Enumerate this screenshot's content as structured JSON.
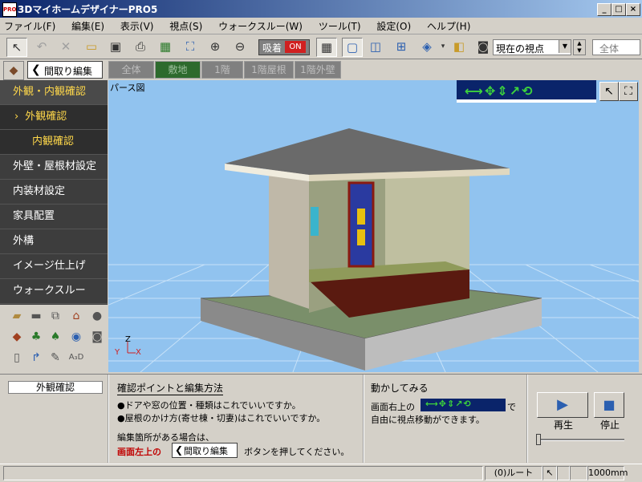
{
  "window": {
    "title": "3DマイホームデザイナーPRO5",
    "icon_text": "PRO"
  },
  "menu": [
    "ファイル(F)",
    "編集(E)",
    "表示(V)",
    "視点(S)",
    "ウォークスルー(W)",
    "ツール(T)",
    "設定(O)",
    "ヘルプ(H)"
  ],
  "toolbar": {
    "adsorb_label": "吸着",
    "adsorb_state": "ON",
    "view_select": "現在の視点",
    "all_field": "全体"
  },
  "row2": {
    "madori_button": "間取り編集",
    "floor_tabs": [
      "全体",
      "敷地",
      "1階",
      "1階屋根",
      "1階外壁"
    ],
    "selected_tab": 1
  },
  "leftnav": [
    {
      "label": "外観・内観確認",
      "style": "gold"
    },
    {
      "label": "外観確認",
      "style": "sub",
      "chevron": "›"
    },
    {
      "label": "内観確認",
      "style": "sub"
    },
    {
      "label": "外壁・屋根材設定",
      "style": "normal"
    },
    {
      "label": "内装材設定",
      "style": "normal"
    },
    {
      "label": "家具配置",
      "style": "normal"
    },
    {
      "label": "外構",
      "style": "normal"
    },
    {
      "label": "イメージ仕上げ",
      "style": "normal"
    },
    {
      "label": "ウォークスルー",
      "style": "normal"
    }
  ],
  "viewport": {
    "label": "パース図",
    "axis_z": "Z",
    "axis_y": "Y",
    "axis_x": "X"
  },
  "bottom": {
    "view_name": "外観確認",
    "check_heading": "確認ポイントと編集方法",
    "bullet1": "●ドアや窓の位置・種類はこれでいいですか。",
    "bullet2": "●屋根のかけ方(寄せ棟・切妻)はこれでいいですか。",
    "edit_hint": "編集箇所がある場合は、",
    "red_label": "画面左上の",
    "madori_button": "間取り編集",
    "press_text": "ボタンを押してください。",
    "move_heading": "動かしてみる",
    "move_line1a": "画面右上の",
    "move_line1b": "で",
    "move_line2": "自由に視点移動ができます。",
    "play_label": "再生",
    "stop_label": "停止"
  },
  "status": {
    "root": "(0)ルート",
    "scale": "1000mm"
  },
  "colors": {
    "sky": "#91c3ef",
    "nav_dark": "#3d3d3d",
    "accent_gold": "#ffd84a",
    "title_blue": "#0a246a"
  }
}
